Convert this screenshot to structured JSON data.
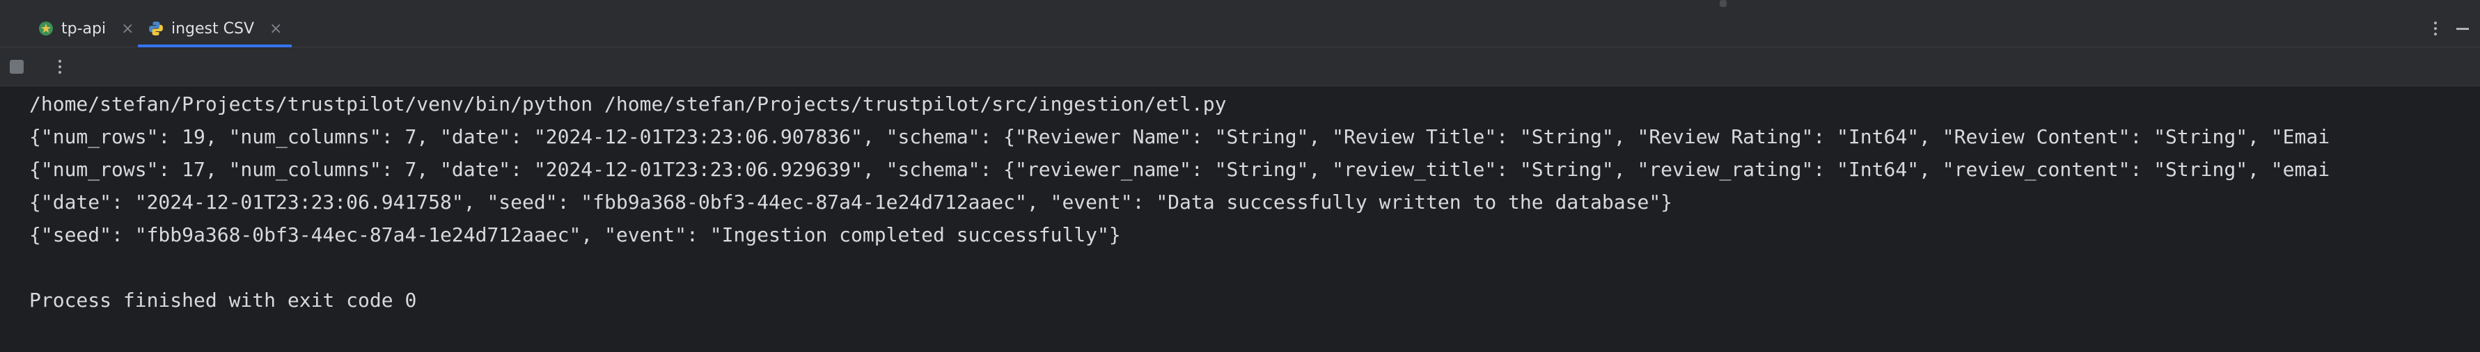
{
  "tabs": [
    {
      "label": "tp-api",
      "icon": "star-icon",
      "close": "×",
      "active": false
    },
    {
      "label": "ingest CSV",
      "icon": "python-icon",
      "close": "×",
      "active": true
    }
  ],
  "console": {
    "lines": [
      "/home/stefan/Projects/trustpilot/venv/bin/python /home/stefan/Projects/trustpilot/src/ingestion/etl.py",
      "{\"num_rows\": 19, \"num_columns\": 7, \"date\": \"2024-12-01T23:23:06.907836\", \"schema\": {\"Reviewer Name\": \"String\", \"Review Title\": \"String\", \"Review Rating\": \"Int64\", \"Review Content\": \"String\", \"Emai",
      "{\"num_rows\": 17, \"num_columns\": 7, \"date\": \"2024-12-01T23:23:06.929639\", \"schema\": {\"reviewer_name\": \"String\", \"review_title\": \"String\", \"review_rating\": \"Int64\", \"review_content\": \"String\", \"emai",
      "{\"date\": \"2024-12-01T23:23:06.941758\", \"seed\": \"fbb9a368-0bf3-44ec-87a4-1e24d712aaec\", \"event\": \"Data successfully written to the database\"}",
      "{\"seed\": \"fbb9a368-0bf3-44ec-87a4-1e24d712aaec\", \"event\": \"Ingestion completed successfully\"}",
      "",
      "Process finished with exit code 0"
    ]
  },
  "colors": {
    "background": "#1e1f22",
    "panel": "#2b2d30",
    "accent": "#3574f0",
    "text": "#d7d9dd"
  }
}
